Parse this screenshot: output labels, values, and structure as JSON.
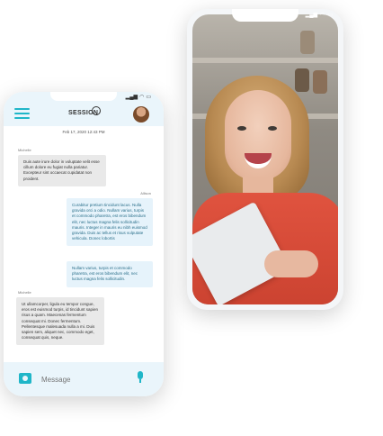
{
  "back_phone": {
    "signal": "▂▄▆",
    "wifi": "◠",
    "battery": "▭"
  },
  "front_phone": {
    "header": {
      "logo_text": "SESSION",
      "signal": "▂▄▆",
      "wifi": "◠",
      "battery": "▭"
    },
    "date": "Feb 17, 2020 12:43 PM",
    "messages": [
      {
        "sender": "Michelle",
        "side": "left",
        "text": "Duis aute irure dolor in voluptate velit esse cillum dolore eu fugiat nulla pariatur. Excepteur sint occaecat cupidatat non proident."
      },
      {
        "sender": "Allison",
        "side": "right",
        "text": "Curabitur pretium tincidunt lacus. Nulla gravida orci a odio. Nullam varius, turpis et commodo pharetra, est eros bibendum elit, nec luctus magna felis sollicitudin mauris. Integer in mauris eu nibh euismod gravida. Duis ac tellus et risus vulputate vehicula. Donec lobortis"
      },
      {
        "sender": "",
        "side": "right",
        "text": "Nullam varius, turpis et commodo pharetra, est eros bibendum elit, nec luctus magna felis sollicitudin."
      },
      {
        "sender": "Michelle",
        "side": "left",
        "text": "Ut ullamcorper, ligula eu tempor congue, eros est euismod turpis, id tincidunt sapien risus a quam. Maecenas fermentum consequat mi. Donec fermentum. Pellentesque malesuada nulla a mi. Duis sapien sem, aliquet nec, commodo eget, consequat quis, neque."
      }
    ],
    "input": {
      "placeholder": "Message"
    }
  }
}
